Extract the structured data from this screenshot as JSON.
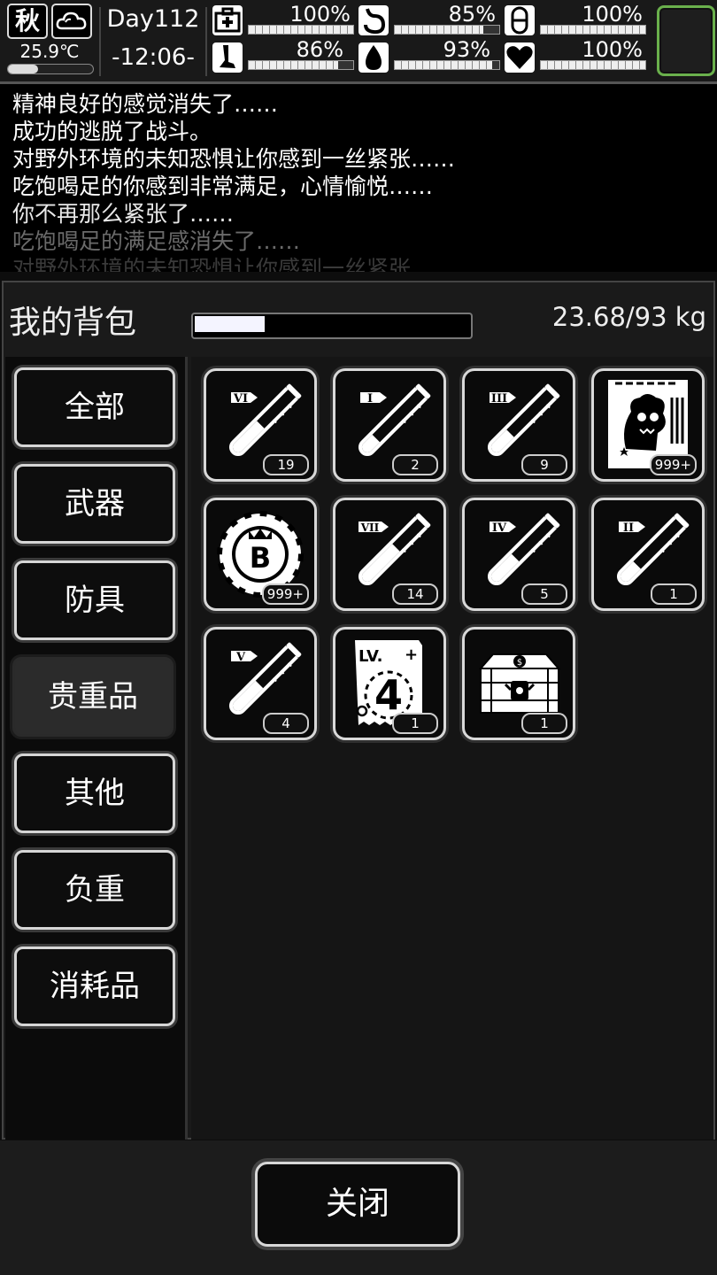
{
  "hud": {
    "season": "秋",
    "weather_icon": "cloud-icon",
    "temperature": "25.9℃",
    "day": "Day112",
    "time": "-12:06-",
    "stats": [
      {
        "name": "health",
        "icon": "medkit-icon",
        "value": "100%",
        "level": 1.0
      },
      {
        "name": "hunger",
        "icon": "stomach-icon",
        "value": "85%",
        "level": 0.85
      },
      {
        "name": "mood",
        "icon": "capsule-icon",
        "value": "100%",
        "level": 1.0
      },
      {
        "name": "stamina",
        "icon": "leg-icon",
        "value": "86%",
        "level": 0.86
      },
      {
        "name": "thirst",
        "icon": "water-drop-icon",
        "value": "93%",
        "level": 0.93
      },
      {
        "name": "heart",
        "icon": "heart-icon",
        "value": "100%",
        "level": 1.0
      }
    ]
  },
  "log": [
    "精神良好的感觉消失了……",
    "成功的逃脱了战斗。",
    "对野外环境的未知恐惧让你感到一丝紧张……",
    "吃饱喝足的你感到非常满足，心情愉悦……",
    "你不再那么紧张了……",
    "吃饱喝足的满足感消失了……",
    "对野外环境的未知恐惧让你感到一丝紧张……"
  ],
  "backpack": {
    "title": "我的背包",
    "weight": "23.68/93 kg",
    "weight_level": 0.2546
  },
  "categories": [
    "全部",
    "武器",
    "防具",
    "贵重品",
    "其他",
    "负重",
    "消耗品"
  ],
  "active_category": "贵重品",
  "items": [
    {
      "icon": "potion-vi-icon",
      "label": "VI",
      "count": "19"
    },
    {
      "icon": "potion-i-icon",
      "label": "I",
      "count": "2"
    },
    {
      "icon": "potion-iii-icon",
      "label": "III",
      "count": "9"
    },
    {
      "icon": "zombie-card-icon",
      "label": "",
      "count": "999+"
    },
    {
      "icon": "b-coin-icon",
      "label": "B",
      "count": "999+"
    },
    {
      "icon": "potion-vii-icon",
      "label": "VII",
      "count": "14"
    },
    {
      "icon": "potion-iv-icon",
      "label": "IV",
      "count": "5"
    },
    {
      "icon": "potion-ii-icon",
      "label": "II",
      "count": "1"
    },
    {
      "icon": "potion-v-icon",
      "label": "V",
      "count": "4"
    },
    {
      "icon": "level-ticket-icon",
      "label": "LV.",
      "level": "4",
      "count": "1"
    },
    {
      "icon": "treasure-chest-icon",
      "label": "",
      "count": "1"
    }
  ],
  "close_label": "关闭"
}
